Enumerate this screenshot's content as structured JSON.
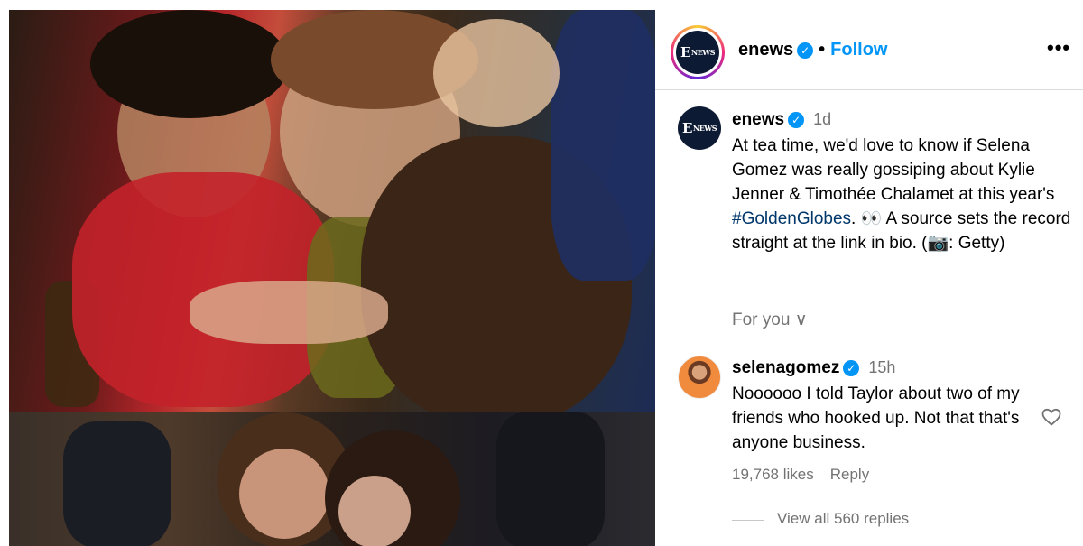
{
  "header": {
    "username": "enews",
    "separator": "•",
    "follow_label": "Follow",
    "more_label": "•••",
    "logo_e": "E",
    "logo_news": "NEWS"
  },
  "caption": {
    "username": "enews",
    "time": "1d",
    "text_before": "At tea time, we'd love to know if Selena Gomez was really gossiping about Kylie Jenner & Timothée Chalamet at this year's ",
    "hashtag": "#GoldenGlobes",
    "text_after": ". 👀 A source sets the record straight at the link in bio. (📷: Getty)"
  },
  "for_you": {
    "label": "For you",
    "chevron": "∨"
  },
  "comment": {
    "username": "selenagomez",
    "time": "15h",
    "text": "Noooooo I told Taylor about two of my friends who hooked up. Not that that's anyone business.",
    "likes": "19,768 likes",
    "reply_label": "Reply"
  },
  "replies": {
    "label": "View all 560 replies"
  },
  "icons": {
    "verified": "✓"
  },
  "colors": {
    "accent": "#0095f6",
    "secondary_text": "#737373",
    "hashtag": "#00376b",
    "logo_bg": "#0d1a33"
  }
}
